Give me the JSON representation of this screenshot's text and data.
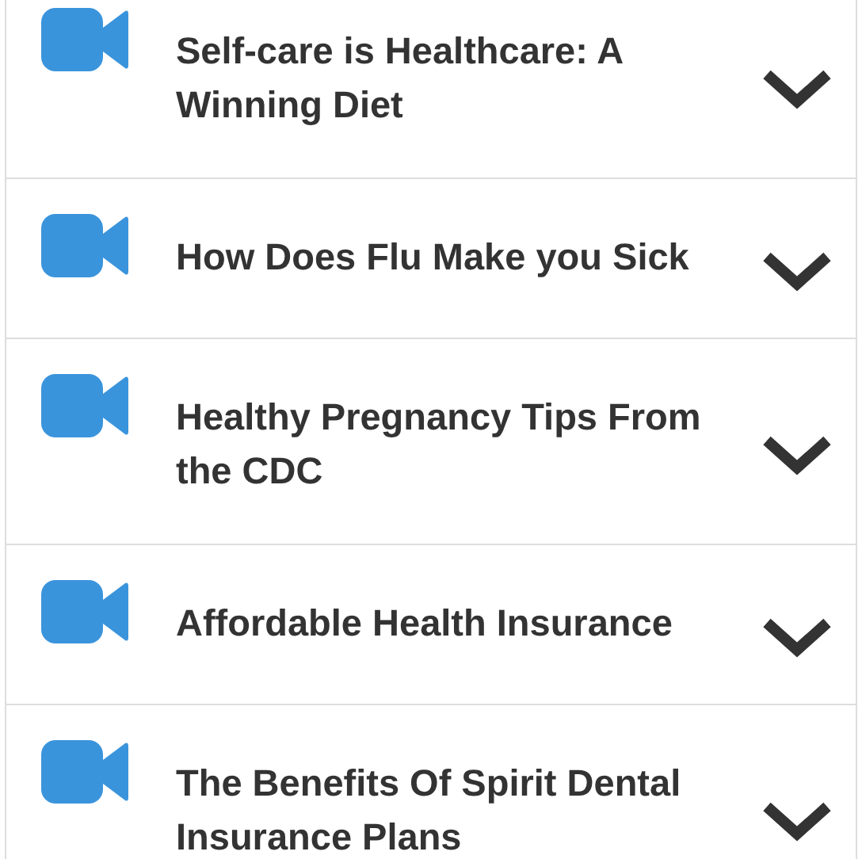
{
  "videos": [
    {
      "title": "Self-care is Healthcare: A Winning Diet",
      "expanded": false
    },
    {
      "title": "How Does Flu Make you Sick",
      "expanded": false
    },
    {
      "title": "Healthy Pregnancy Tips From the CDC",
      "expanded": false
    },
    {
      "title": "Affordable Health Insurance",
      "expanded": false
    },
    {
      "title": "The Benefits Of Spirit Dental Insurance Plans",
      "expanded": false
    }
  ]
}
